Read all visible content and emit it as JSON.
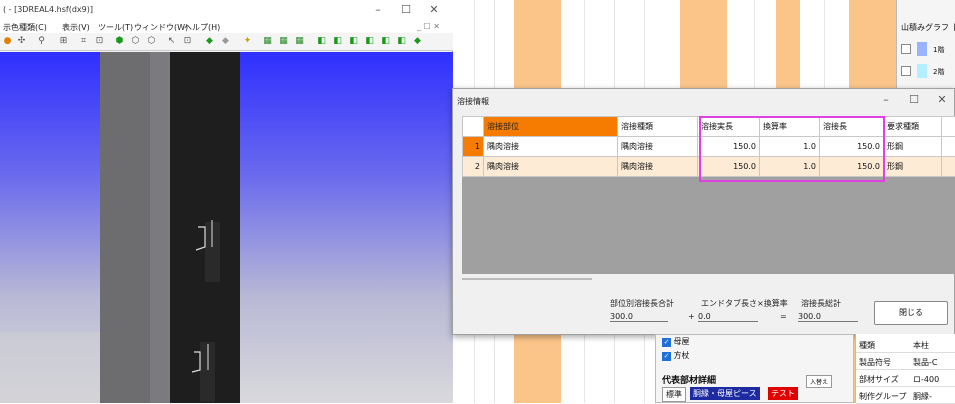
{
  "left_window": {
    "title": "( - [3DREAL4.hsf(dx9)]",
    "controls": {
      "minimize": "–",
      "maximize": "☐",
      "close": "✕"
    },
    "menus": [
      "示色種類(C)",
      "表示(V)",
      "ツール(T)",
      "ウィンドウ(W)",
      "ヘルプ(H)"
    ],
    "mdi_controls": "_ ☐ ✕"
  },
  "right_panel": {
    "header": "山積みグラフ【",
    "rows": [
      "1階",
      "2階"
    ]
  },
  "dialog": {
    "title": "溶接情報",
    "controls": {
      "minimize": "–",
      "maximize": "☐",
      "close": "✕"
    },
    "columns": [
      "溶接部位",
      "溶接種類",
      "溶接実長",
      "換算率",
      "溶接長",
      "要求種類"
    ],
    "rows": [
      {
        "no": "1",
        "part": "隅肉溶接",
        "type": "隅肉溶接",
        "length": "150.0",
        "rate": "1.0",
        "weld_length": "150.0",
        "req": "形鋼"
      },
      {
        "no": "2",
        "part": "隅肉溶接",
        "type": "隅肉溶接",
        "length": "150.0",
        "rate": "1.0",
        "weld_length": "150.0",
        "req": "形鋼"
      }
    ],
    "footer": {
      "part_total_label": "部位別溶接長合計",
      "part_total": "300.0",
      "plus": "+",
      "endtab_label": "エンドタブ長さ×換算率",
      "endtab_value": "0.0",
      "equals": "=",
      "grand_label": "溶接長総計",
      "grand_total": "300.0"
    },
    "close_label": "閉じる"
  },
  "tree": {
    "items": [
      "母屋",
      "方杖"
    ],
    "category": "代表部材詳細",
    "badge": "入替え",
    "tabs": [
      "標準",
      "胴縁・母屋ピース",
      "テスト"
    ]
  },
  "props": [
    {
      "key": "種類",
      "value": "本柱"
    },
    {
      "key": "製品符号",
      "value": "製品-C"
    },
    {
      "key": "部材サイズ",
      "value": "ロ-400"
    },
    {
      "key": "制作グループ",
      "value": "胴縁-"
    }
  ],
  "colors": {
    "accent": "#f57c00",
    "highlight": "#e040e0",
    "bar": "#fbc58a"
  }
}
